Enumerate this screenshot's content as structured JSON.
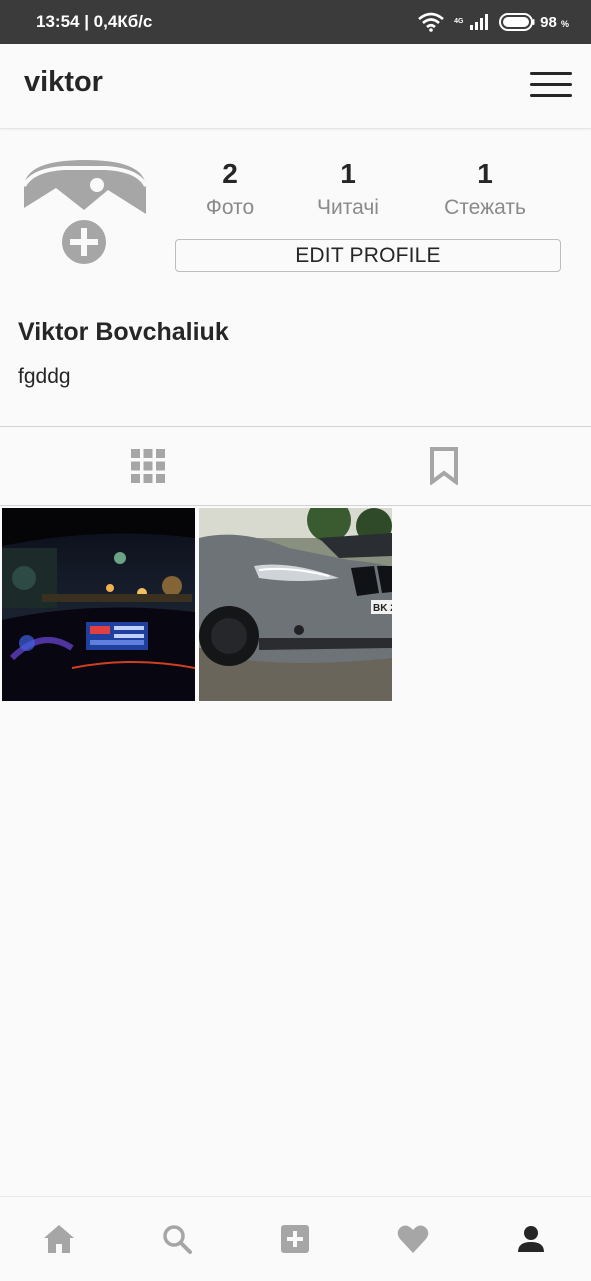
{
  "status_bar": {
    "time_speed": "13:54 | 0,4Кб/с",
    "network_type": "4G",
    "battery_percent": "98",
    "battery_unit": "%"
  },
  "header": {
    "username": "viktor",
    "menu_icon": "hamburger-menu-icon"
  },
  "profile": {
    "avatar_icon": "add-photo-icon",
    "stats": [
      {
        "value": "2",
        "label": "Фото"
      },
      {
        "value": "1",
        "label": "Читачі"
      },
      {
        "value": "1",
        "label": "Стежать"
      }
    ],
    "edit_button": "EDIT PROFILE",
    "full_name": "Viktor Bovchaliuk",
    "bio": "fgddg"
  },
  "tabs": [
    {
      "icon": "grid-icon",
      "active": true
    },
    {
      "icon": "bookmark-icon",
      "active": false
    }
  ],
  "posts": [
    {
      "description": "night car interior photo"
    },
    {
      "description": "grey car front photo",
      "plate_text": "BK 2"
    }
  ],
  "bottom_nav": [
    {
      "icon": "home-icon"
    },
    {
      "icon": "search-icon"
    },
    {
      "icon": "add-post-icon"
    },
    {
      "icon": "heart-icon"
    },
    {
      "icon": "profile-icon",
      "active": true
    }
  ],
  "colors": {
    "status_bar_bg": "#3b3b3b",
    "icon_grey": "#a6a6a6",
    "text_dark": "#262626"
  }
}
